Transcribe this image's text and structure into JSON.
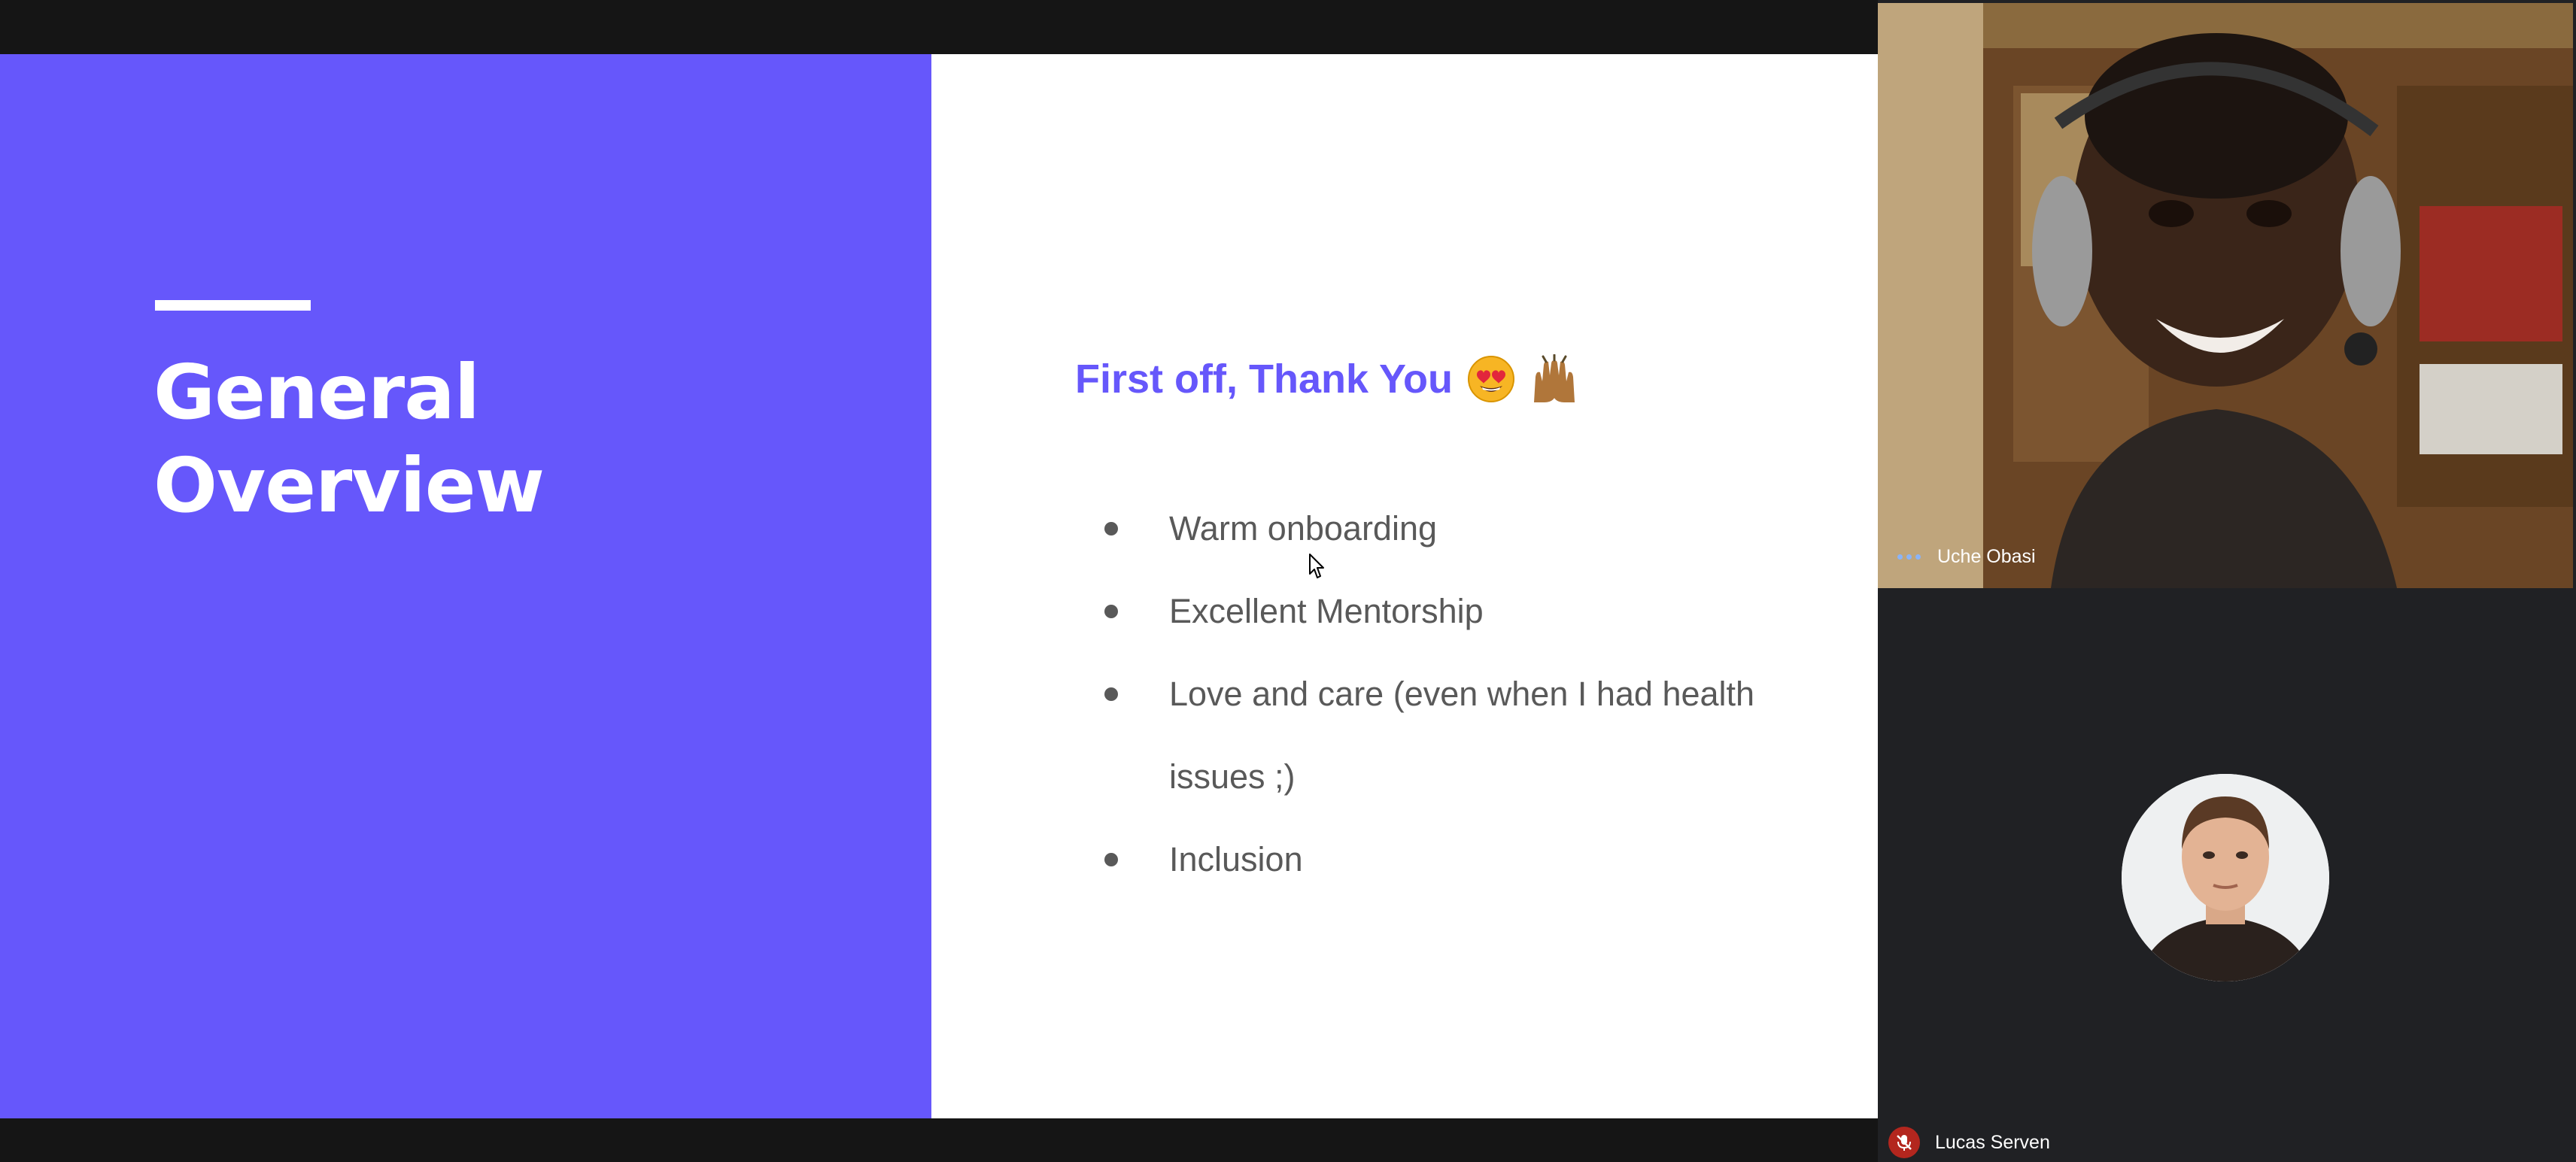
{
  "meeting": {
    "presentation": {
      "title_lines": [
        "General",
        "Overview"
      ],
      "heading": "First off, Thank You",
      "heading_emojis": [
        "heart-eyes-emoji",
        "raising-hands-emoji"
      ],
      "bullets": [
        {
          "lines": [
            "Warm onboarding"
          ]
        },
        {
          "lines": [
            "Excellent Mentorship"
          ]
        },
        {
          "lines": [
            "Love and care (even when I had health",
            "issues ;)"
          ]
        },
        {
          "lines": [
            "Inclusion"
          ]
        }
      ],
      "colors": {
        "accent": "#6657fb",
        "body_text": "#595959",
        "background": "#ffffff"
      }
    },
    "participants": [
      {
        "name": "Uche Obasi",
        "video": "on",
        "status_icon": "more-options-icon"
      },
      {
        "name": "Lucas Serven",
        "video": "off",
        "status_icon": "mic-off-icon"
      }
    ]
  }
}
